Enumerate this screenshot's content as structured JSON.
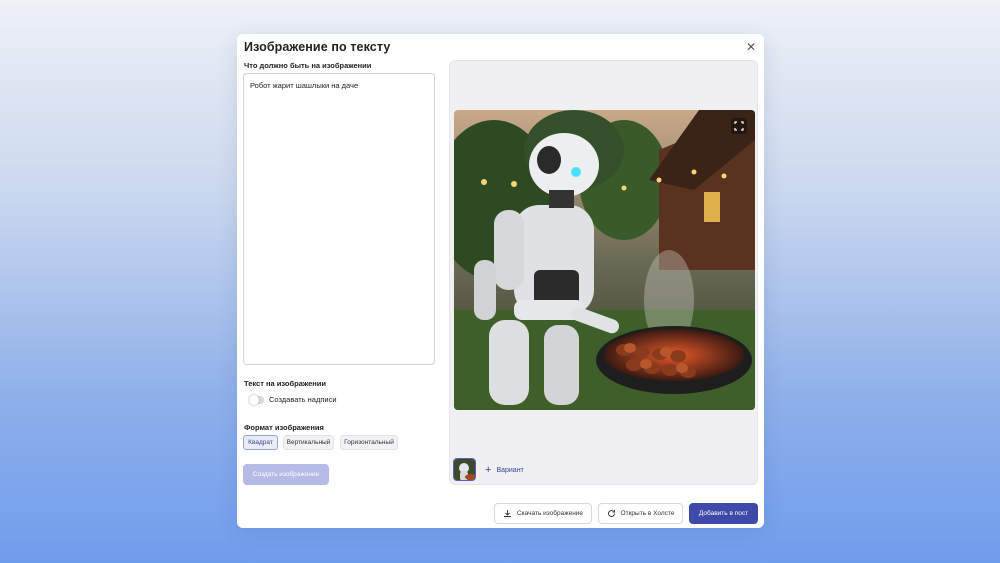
{
  "dialog": {
    "title": "Изображение по тексту",
    "close_icon": "close-icon"
  },
  "prompt": {
    "label": "Что должно быть на изображении",
    "value": "Робот жарит шашлыки на даче"
  },
  "text_on_image": {
    "label": "Текст на изображении",
    "toggle_label": "Создавать надписи",
    "toggle_on": false
  },
  "format": {
    "label": "Формат изображения",
    "options": [
      "Квадрат",
      "Вертикальный",
      "Горизонтальный"
    ],
    "selected": "Квадрат"
  },
  "actions": {
    "create_label": "Создать изображение",
    "variant_label": "Вариант",
    "download_label": "Скачать изображение",
    "open_canvas_label": "Открыть в Холсте",
    "add_post_label": "Добавить в пост"
  },
  "colors": {
    "accent": "#3f4aa8",
    "accent_disabled": "#b5bbe6"
  }
}
